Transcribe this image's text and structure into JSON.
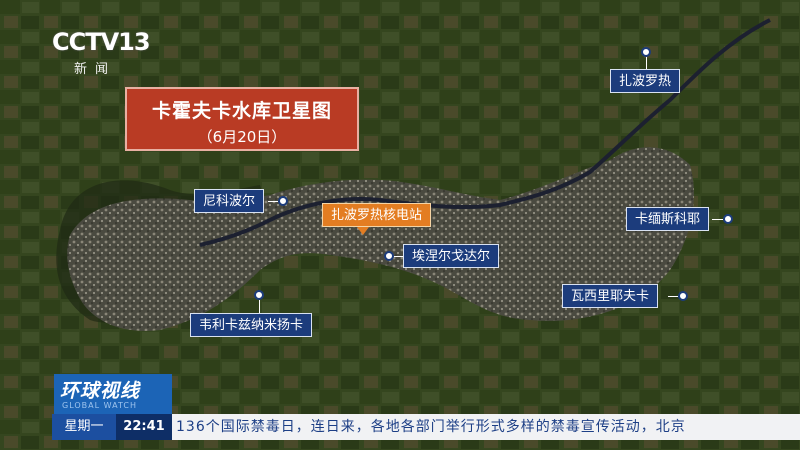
{
  "logo": {
    "main": "CCTV13",
    "sub": "新闻"
  },
  "title": {
    "main": "卡霍夫卡水库卫星图",
    "date": "（6月20日）"
  },
  "places": {
    "zaporizhzhia": "扎波罗热",
    "nikopol": "尼科波尔",
    "npp": "扎波罗热核电站",
    "enerhodar": "埃涅尔戈达尔",
    "kamianka": "卡缅斯科耶",
    "vasylivka": "瓦西里耶夫卡",
    "velyka": "韦利卡兹纳米扬卡"
  },
  "brand": {
    "name": "环球视线",
    "en": "GLOBAL WATCH"
  },
  "ticker": {
    "day": "星期一",
    "time": "22:41",
    "text": "136个国际禁毒日，连日来，各地各部门举行形式多样的禁毒宣传活动，北京"
  },
  "colors": {
    "title_bg": "#b93b24",
    "label_bg": "#1c3c7c",
    "label_orange": "#e37d22",
    "ticker_day": "#1c4fa0"
  }
}
